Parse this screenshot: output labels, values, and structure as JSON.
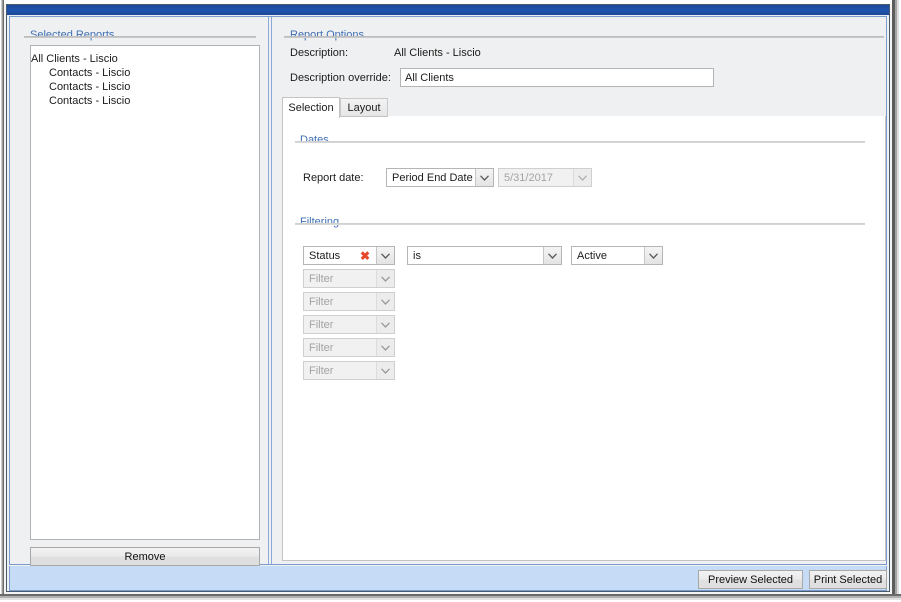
{
  "window": {
    "titlebar_color": "#1f55ad",
    "body_background": "#eff0f1",
    "bottom_bar_color": "#c6dcf6",
    "accent_color": "#3f6fb5",
    "selection_color": "#3a9ae8",
    "delete_icon_color": "#e8492b"
  },
  "left_pane": {
    "group_title": "Selected Reports",
    "reports": [
      {
        "label": "All Clients - Liscio",
        "selected": true
      },
      {
        "label": "Contacts - Liscio",
        "selected": false
      },
      {
        "label": "Contacts - Liscio",
        "selected": false
      },
      {
        "label": "Contacts - Liscio",
        "selected": false
      }
    ],
    "remove_label": "Remove"
  },
  "right_pane": {
    "group_title": "Report Options",
    "description_label": "Description:",
    "description_value": "All Clients - Liscio",
    "description_override_label": "Description override:",
    "description_override_value": "All Clients",
    "description_override_placeholder": "",
    "tabs": [
      {
        "label": "Selection",
        "active": true
      },
      {
        "label": "Layout",
        "active": false
      }
    ],
    "dates": {
      "group_title": "Dates",
      "report_date_label": "Report date:",
      "report_date_value": "Period End Date",
      "report_date_options": [
        "Period End Date"
      ],
      "date_picker_value": "5/31/2017",
      "date_picker_enabled": false
    },
    "filtering": {
      "group_title": "Filtering",
      "active_filter": {
        "field": "Status",
        "delete_icon": "red-x-icon",
        "operator": "is",
        "value": "Active"
      },
      "empty_filter_placeholder": "Filter",
      "empty_filter_count": 5
    }
  },
  "bottom_bar": {
    "preview_label": "Preview Selected",
    "print_label": "Print Selected"
  }
}
